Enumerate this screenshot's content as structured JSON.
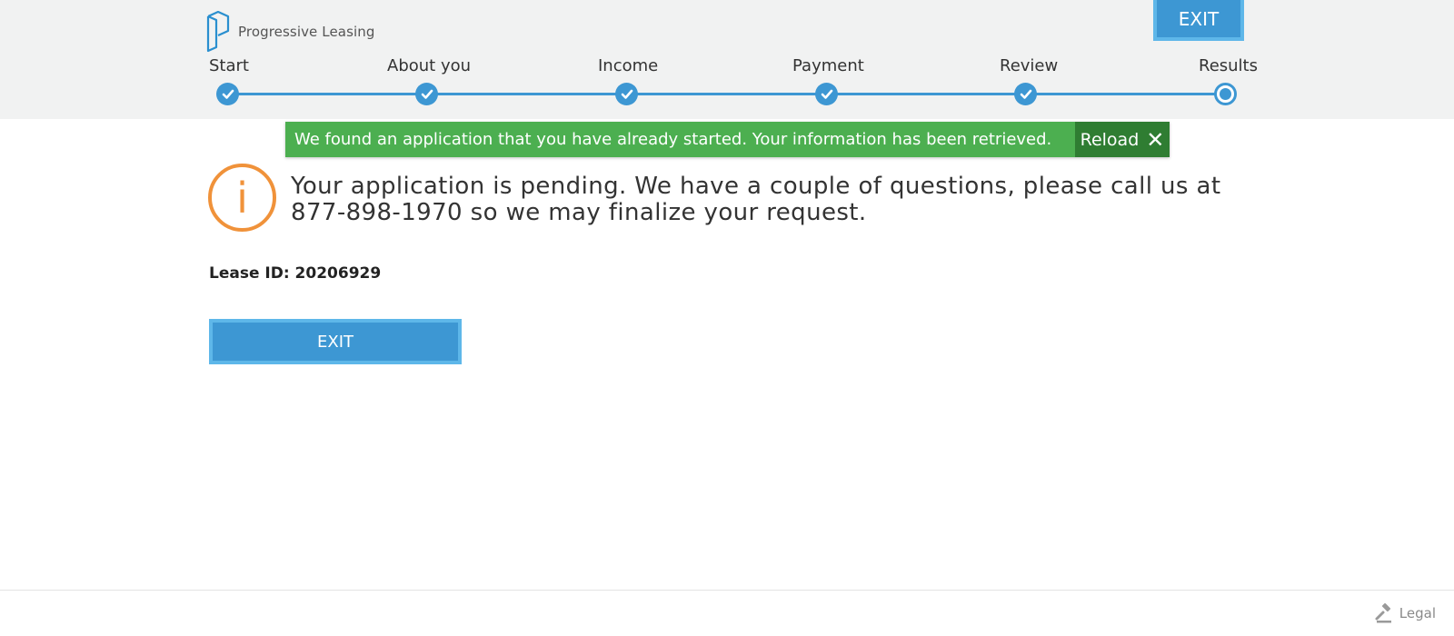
{
  "brand": {
    "name": "Progressive Leasing",
    "logo_icon": "p-logo-icon",
    "accent_color": "#3d97d3"
  },
  "header": {
    "exit_label": "EXIT"
  },
  "steps": [
    {
      "label": "Start",
      "status": "complete"
    },
    {
      "label": "About you",
      "status": "complete"
    },
    {
      "label": "Income",
      "status": "complete"
    },
    {
      "label": "Payment",
      "status": "complete"
    },
    {
      "label": "Review",
      "status": "complete"
    },
    {
      "label": "Results",
      "status": "current"
    }
  ],
  "notice": {
    "message": "We found an application that you have already started. Your information has been retrieved.",
    "reload_label": "Reload",
    "close_icon": "close-icon",
    "color": "#4caf50"
  },
  "result": {
    "icon": "info-icon",
    "message": "Your application is pending. We have a couple of questions, please call us at 877-898-1970 so we may finalize your request.",
    "lease_id_text": "Lease ID: 20206929",
    "exit_label": "EXIT"
  },
  "footer": {
    "legal_label": "Legal",
    "legal_icon": "gavel-icon"
  }
}
